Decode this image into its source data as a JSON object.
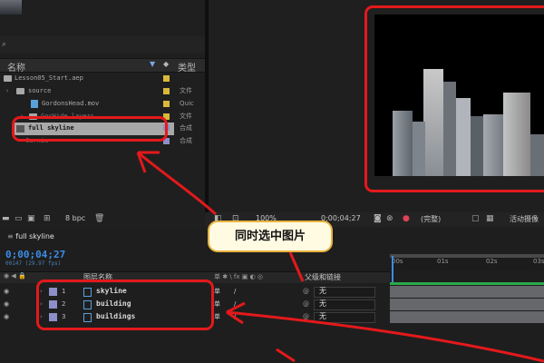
{
  "project_panel": {
    "column_name": "名称",
    "column_type": "类型",
    "items": [
      {
        "name": "Lesson05_Start.aep",
        "type": "",
        "swatch": "#d9b93a"
      },
      {
        "name": "source",
        "type": "文件",
        "swatch": "#d9b93a"
      },
      {
        "name": "GordonsHead.mov",
        "type": "Quic",
        "swatch": "#d9b93a"
      },
      {
        "name": "GorHide layers",
        "type": "文件",
        "swatch": "#d9b93a"
      },
      {
        "name": "full skyline",
        "type": "合成",
        "swatch": "#8e8ec8"
      },
      {
        "name": "Carnie",
        "type": "合成",
        "swatch": "#8e8ec8"
      }
    ],
    "bpc": "8 bpc"
  },
  "viewer_toolbar": {
    "zoom": "100%",
    "timecode": "0;00;04;27",
    "resolution": "(完整)",
    "active_camera": "活动摄像"
  },
  "timeline": {
    "tab_name": "full skyline",
    "timecode": "0;00;04;27",
    "fps": "00147 (29.97 fps)",
    "layer_column": "图层名称",
    "parent_column": "父级和链接",
    "layers": [
      {
        "num": "1",
        "name": "skyline",
        "parent": "无"
      },
      {
        "num": "2",
        "name": "building",
        "parent": "无"
      },
      {
        "num": "3",
        "name": "buildings",
        "parent": "无"
      }
    ],
    "ruler": [
      "00s",
      "01s",
      "02s",
      "03s"
    ]
  },
  "callout": {
    "text": "同时选中图片"
  },
  "colors": {
    "accent_blue": "#3d8ce6",
    "annotation_red": "#e3191b",
    "layer_label": "#8e8ec8"
  }
}
